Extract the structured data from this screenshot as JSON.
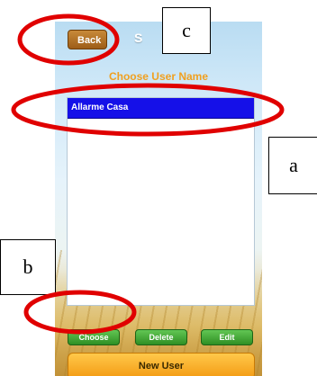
{
  "header": {
    "back_label": "Back",
    "title": "S"
  },
  "main": {
    "heading": "Choose User Name",
    "users": [
      "Allarme Casa"
    ],
    "buttons": {
      "choose": "Choose",
      "delete": "Delete",
      "edit": "Edit"
    },
    "new_user": "New User"
  },
  "annotations": {
    "a": "a",
    "b": "b",
    "c": "c"
  },
  "colors": {
    "highlight_ellipse": "#e00000",
    "selected_row": "#1510e8",
    "button_green": "#3aa02c",
    "button_orange": "#f7a824"
  }
}
